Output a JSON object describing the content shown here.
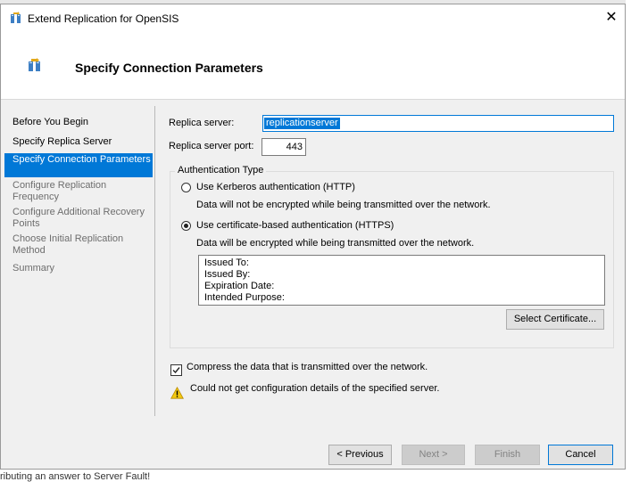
{
  "window": {
    "title": "Extend Replication for OpenSIS",
    "close_glyph": "✕"
  },
  "header": {
    "title": "Specify Connection Parameters"
  },
  "nav": {
    "items": [
      {
        "label": "Before You Begin",
        "state": "done"
      },
      {
        "label": "Specify Replica Server",
        "state": "done"
      },
      {
        "label": "Specify Connection Parameters",
        "state": "active"
      },
      {
        "label": "Configure Replication Frequency",
        "state": "disabled"
      },
      {
        "label": "Configure Additional Recovery Points",
        "state": "disabled"
      },
      {
        "label": "Choose Initial Replication Method",
        "state": "disabled"
      },
      {
        "label": "Summary",
        "state": "disabled"
      }
    ]
  },
  "form": {
    "replica_server_label": "Replica server:",
    "replica_server_value": "replicationserver",
    "replica_port_label": "Replica server port:",
    "replica_port_value": "443"
  },
  "auth": {
    "group_title": "Authentication Type",
    "kerberos_label": "Use Kerberos authentication (HTTP)",
    "kerberos_selected": false,
    "kerberos_note": "Data will not be encrypted while being transmitted over the network.",
    "certificate_label": "Use certificate-based authentication (HTTPS)",
    "certificate_selected": true,
    "certificate_note": "Data will be encrypted while being transmitted over the network.",
    "cert_details": {
      "issued_to": "Issued To:",
      "issued_by": "Issued By:",
      "expiration": "Expiration Date:",
      "purpose": "Intended Purpose:"
    },
    "select_certificate_button": "Select Certificate..."
  },
  "compress": {
    "label": "Compress the data that is transmitted over the network.",
    "checked": true
  },
  "warning": {
    "text": "Could not get configuration details of the specified server."
  },
  "buttons": {
    "previous": "< Previous",
    "next": "Next >",
    "finish": "Finish",
    "cancel": "Cancel"
  },
  "background": {
    "bottom_text": "ributing an answer to Server Fault!"
  },
  "colors": {
    "selection": "#0078d7",
    "warning": "#f2c811"
  }
}
